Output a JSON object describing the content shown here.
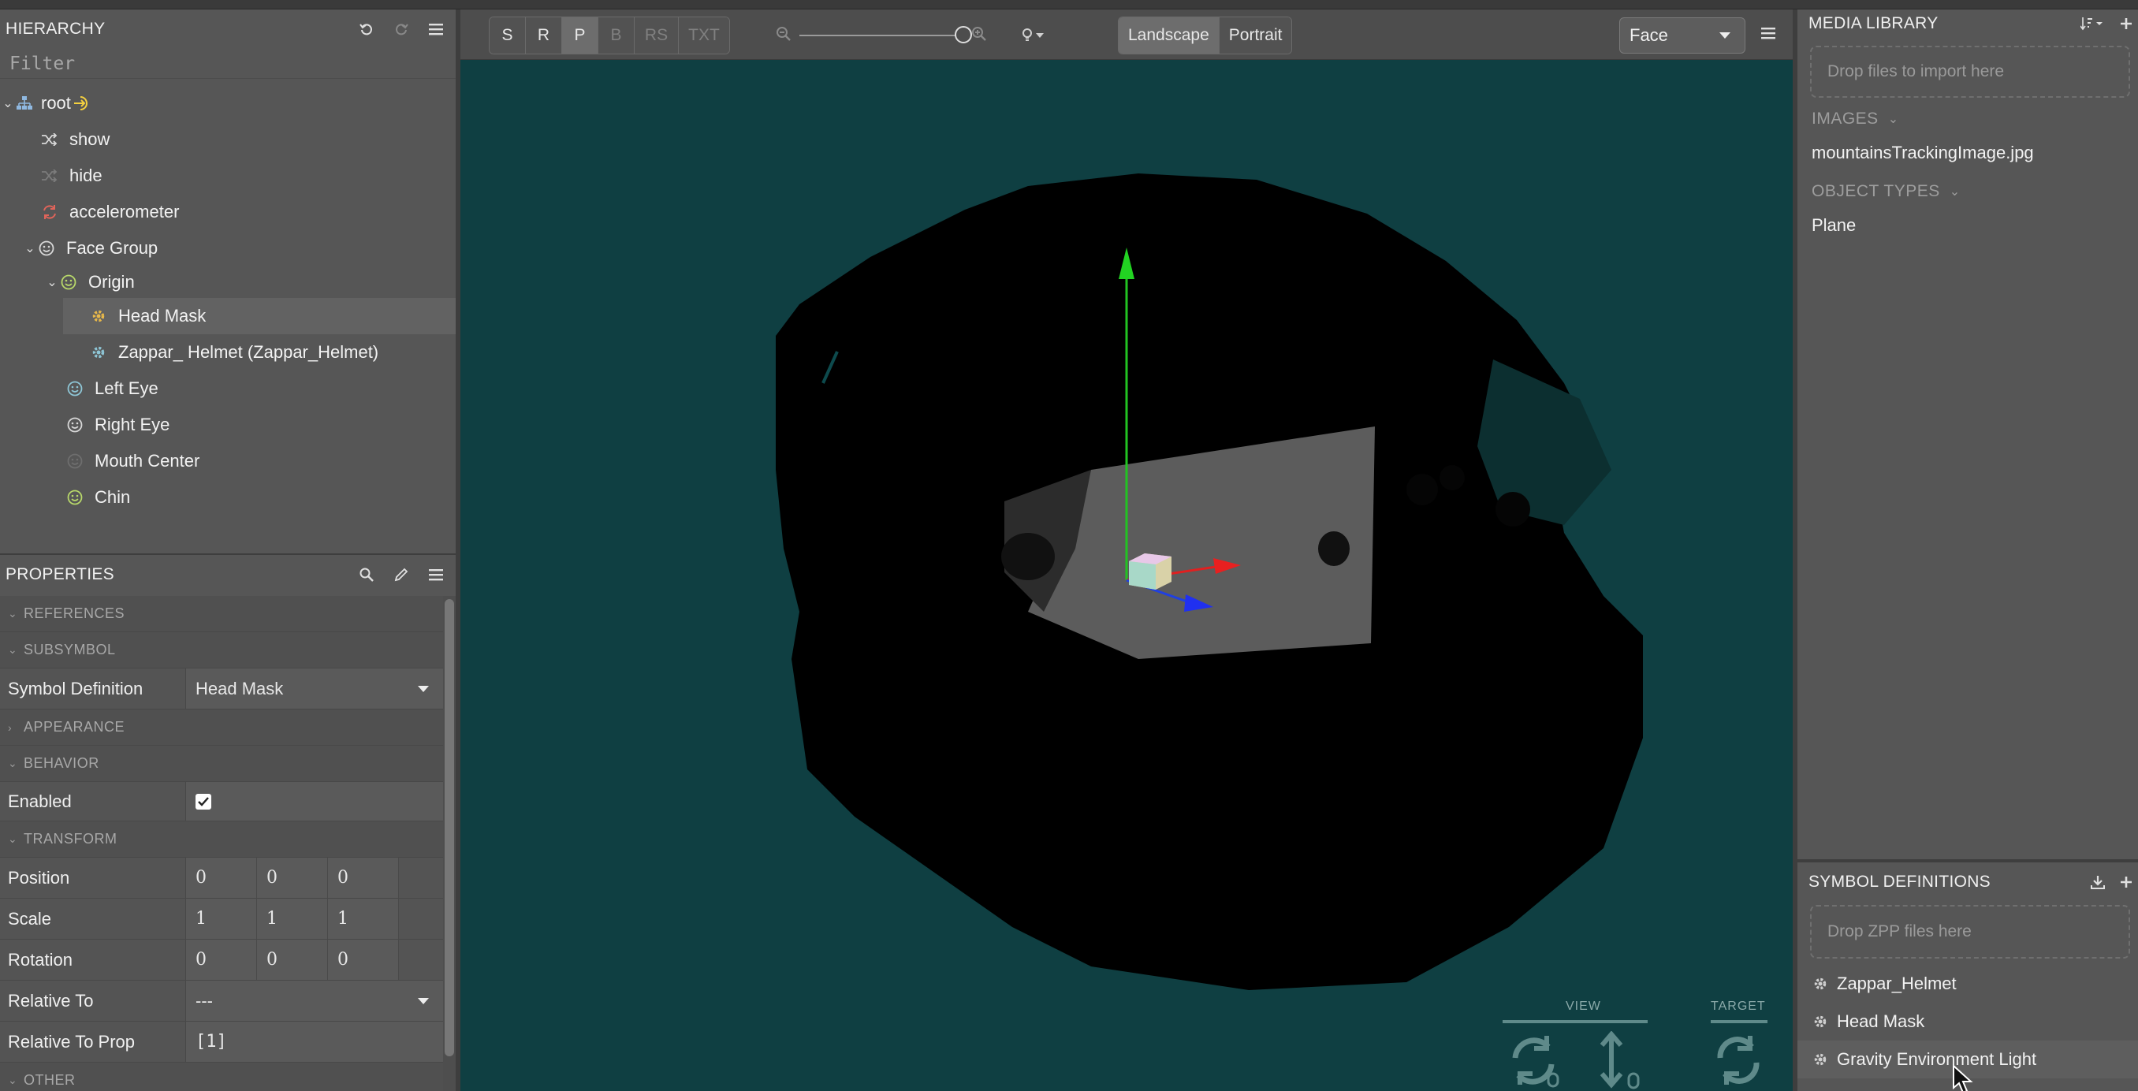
{
  "hierarchy": {
    "title": "HIERARCHY",
    "filter_placeholder": "Filter",
    "items": [
      {
        "label": "root"
      },
      {
        "label": "show"
      },
      {
        "label": "hide"
      },
      {
        "label": "accelerometer"
      },
      {
        "label": "Face Group"
      },
      {
        "label": "Origin"
      },
      {
        "label": "Head Mask"
      },
      {
        "label": "Zappar_ Helmet (Zappar_Helmet)"
      },
      {
        "label": "Left Eye"
      },
      {
        "label": "Right Eye"
      },
      {
        "label": "Mouth Center"
      },
      {
        "label": "Chin"
      }
    ]
  },
  "properties": {
    "title": "PROPERTIES",
    "sections": {
      "references": "REFERENCES",
      "subsymbol": "SUBSYMBOL",
      "appearance": "APPEARANCE",
      "behavior": "BEHAVIOR",
      "transform": "TRANSFORM",
      "other": "OTHER"
    },
    "symbol_definition": {
      "label": "Symbol Definition",
      "value": "Head Mask"
    },
    "enabled": {
      "label": "Enabled",
      "checked": true
    },
    "position": {
      "label": "Position",
      "x": "0",
      "y": "0",
      "z": "0"
    },
    "scale": {
      "label": "Scale",
      "x": "1",
      "y": "1",
      "z": "1"
    },
    "rotation": {
      "label": "Rotation",
      "x": "0",
      "y": "0",
      "z": "0"
    },
    "relative_to": {
      "label": "Relative To",
      "value": "---"
    },
    "relative_to_prop": {
      "label": "Relative To Prop",
      "value": "[1]"
    }
  },
  "viewport": {
    "modes": [
      "S",
      "R",
      "P",
      "B",
      "RS",
      "TXT"
    ],
    "active_mode": "P",
    "orientation": [
      "Landscape",
      "Portrait"
    ],
    "active_orientation": "Landscape",
    "zoom": 1.0,
    "tracking_select": "Face",
    "view_label": "VIEW",
    "target_label": "TARGET",
    "background_color": "#0f3f42"
  },
  "media_library": {
    "title": "MEDIA LIBRARY",
    "drop_text": "Drop files to import here",
    "images_label": "IMAGES",
    "images": [
      "mountainsTrackingImage.jpg"
    ],
    "object_types_label": "OBJECT TYPES",
    "object_types": [
      "Plane"
    ]
  },
  "symbol_definitions": {
    "title": "SYMBOL DEFINITIONS",
    "drop_text": "Drop ZPP files here",
    "items": [
      "Zappar_Helmet",
      "Head Mask",
      "Gravity Environment Light"
    ]
  }
}
